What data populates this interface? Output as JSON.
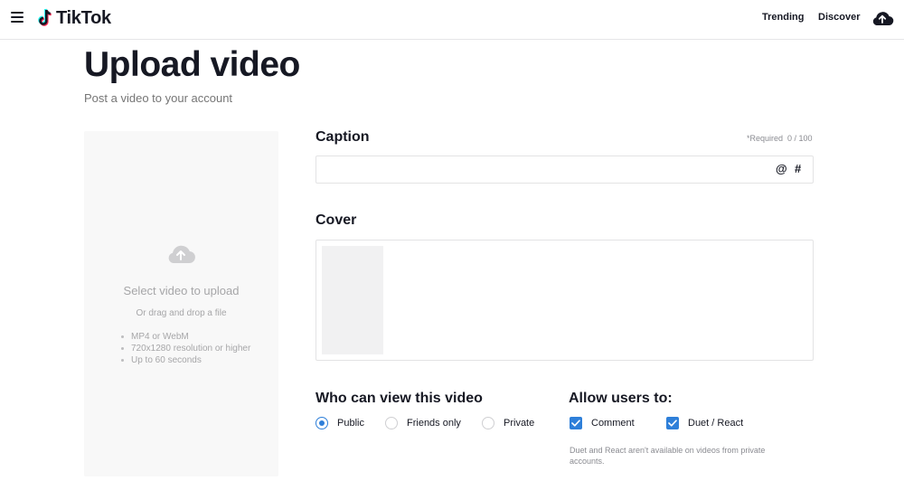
{
  "header": {
    "logo_text": "TikTok",
    "nav": {
      "trending": "Trending",
      "discover": "Discover"
    }
  },
  "page": {
    "title": "Upload video",
    "subtitle": "Post a video to your account"
  },
  "upload": {
    "title": "Select video to upload",
    "drag_text": "Or drag and drop a file",
    "requirements": [
      "MP4 or WebM",
      "720x1280 resolution or higher",
      "Up to 60 seconds"
    ]
  },
  "caption": {
    "label": "Caption",
    "required_text": "*Required",
    "count": "0 / 100",
    "value": "",
    "mention_symbol": "@",
    "hashtag_symbol": "#"
  },
  "cover": {
    "label": "Cover"
  },
  "privacy": {
    "label": "Who can view this video",
    "options": [
      "Public",
      "Friends only",
      "Private"
    ],
    "selected": "Public"
  },
  "allow": {
    "label": "Allow users to:",
    "options": [
      {
        "label": "Comment",
        "checked": true
      },
      {
        "label": "Duet / React",
        "checked": true
      }
    ],
    "note": "Duet and React aren't available on videos from private accounts."
  },
  "colors": {
    "accent": "#2e7fd9",
    "brand_cyan": "#25f4ee",
    "brand_red": "#fe2c55"
  },
  "icons": {
    "menu": "hamburger-icon",
    "upload": "cloud-upload-icon",
    "check": "checkmark-icon"
  }
}
